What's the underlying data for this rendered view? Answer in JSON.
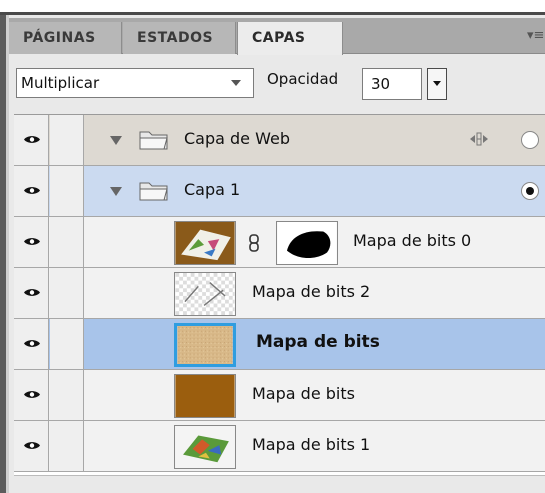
{
  "tabs": [
    {
      "label": "PÁGINAS",
      "active": false
    },
    {
      "label": "ESTADOS",
      "active": false
    },
    {
      "label": "CAPAS",
      "active": true
    }
  ],
  "panel_menu_icon": "panel-menu-icon",
  "blend_mode": "Multiplicar",
  "opacity": {
    "label": "Opacidad",
    "value": "30"
  },
  "layers": [
    {
      "name": "Capa de Web",
      "type": "folder",
      "expanded": true,
      "visible": true
    },
    {
      "name": "Capa 1",
      "type": "folder",
      "expanded": true,
      "visible": true,
      "target_active": true
    },
    {
      "name": "Mapa de bits 0",
      "type": "bitmap",
      "masked": true,
      "visible": true
    },
    {
      "name": "Mapa de bits 2",
      "type": "bitmap",
      "visible": true
    },
    {
      "name": "Mapa de bits",
      "type": "bitmap",
      "selected": true,
      "visible": true
    },
    {
      "name": "Mapa de bits",
      "type": "bitmap",
      "visible": true
    },
    {
      "name": "Mapa de bits 1",
      "type": "bitmap",
      "visible": true
    }
  ],
  "colors": {
    "selected_row": "#a8c4ea",
    "folder_row": "#cbdaf0",
    "thumb_border_selected": "#2f9de0"
  }
}
